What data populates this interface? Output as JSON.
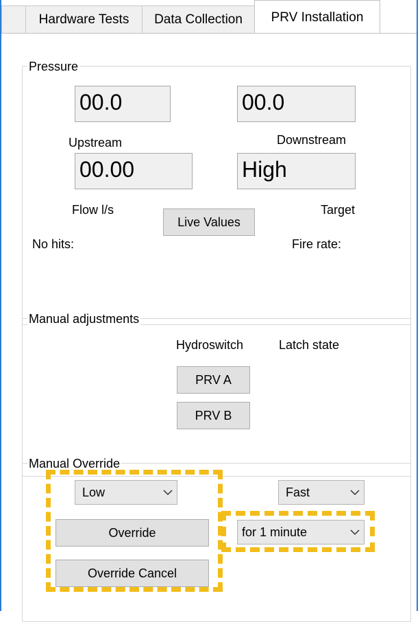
{
  "tabs": [
    {
      "label": "Hardware Tests"
    },
    {
      "label": "Data Collection"
    },
    {
      "label": "PRV Installation"
    }
  ],
  "pressure": {
    "title": "Pressure",
    "upstream_value": "00.0",
    "upstream_label": "Upstream",
    "downstream_value": "00.0",
    "downstream_label": "Downstream",
    "flow_value": "00.00",
    "flow_label": "Flow l/s",
    "target_value": "High",
    "target_label": "Target",
    "live_values_button": "Live Values",
    "no_hits_label": "No hits:",
    "fire_rate_label": "Fire rate:"
  },
  "manual_adjustments": {
    "title": "Manual adjustments",
    "hydroswitch_label": "Hydroswitch",
    "latch_state_label": "Latch state",
    "prv_a_button": "PRV A",
    "prv_b_button": "PRV B"
  },
  "manual_override": {
    "title": "Manual Override",
    "level_select": "Low",
    "speed_select": "Fast",
    "duration_select": "for 1 minute",
    "override_button": "Override",
    "override_cancel_button": "Override Cancel"
  },
  "colors": {
    "window_border": "#2b7bd6",
    "highlight": "#f2bd1a"
  }
}
